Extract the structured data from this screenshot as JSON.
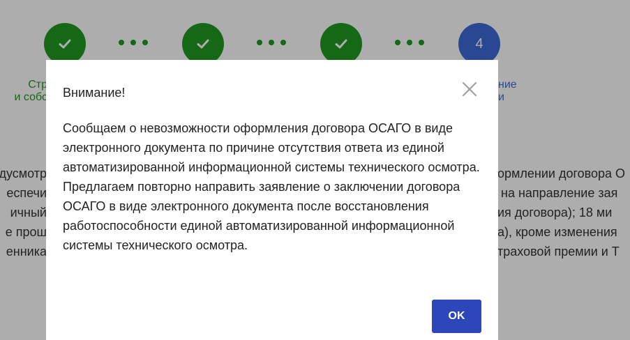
{
  "stepper": {
    "current_step": "4",
    "left_label_line1": "Стр",
    "left_label_line2": "и собс",
    "right_label_line1": "ние",
    "right_label_line2": "и"
  },
  "background_text": {
    "left_lines": [
      "дусмотр",
      "еспечи",
      "ичный",
      "е прош",
      "енника"
    ],
    "right_lines": [
      "ормлении договора О",
      " на направление зая",
      "ия договора); 18 ми",
      "а), кроме изменения",
      "траховой премии и Т"
    ]
  },
  "modal": {
    "title": "Внимание!",
    "message": "Сообщаем о невозможности оформления договора ОСАГО в виде электронного документа по причине отсутствия ответа из единой автоматизированной информационной системы технического осмотра. Предлагаем повторно направить заявление о заключении договора ОСАГО в виде электронного документа после восстановления работоспособности единой автоматизированной информационной системы технического осмотра.",
    "ok_label": "OK"
  },
  "colors": {
    "step_done": "#1f9a1f",
    "step_current": "#3f6ad8",
    "ok_button": "#2d46b9",
    "overlay": "rgba(0,0,0,0.32)"
  },
  "icons": {
    "step_done": "check-icon",
    "close": "close-icon"
  }
}
